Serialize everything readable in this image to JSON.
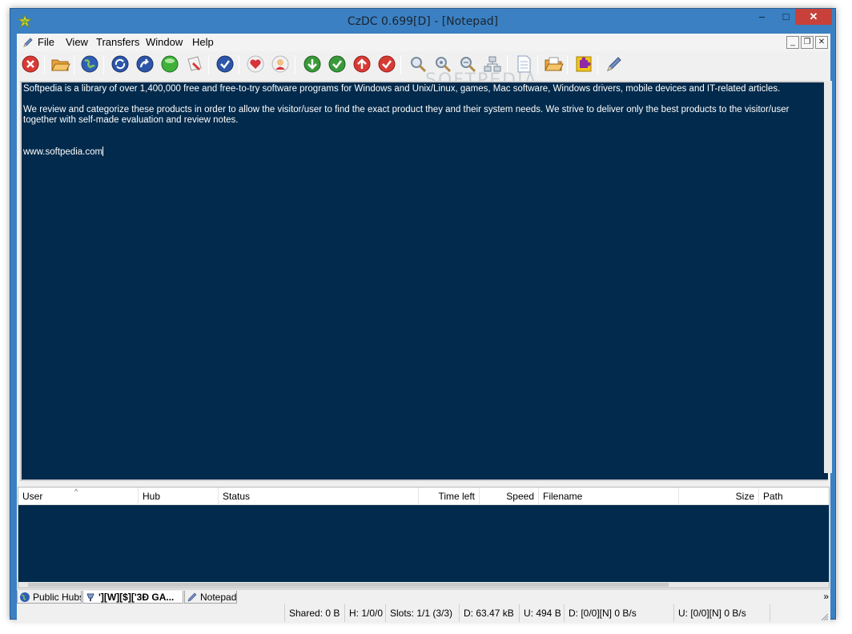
{
  "window": {
    "title": "CzDC 0.699[D] - [Notepad]",
    "controls": {
      "minimize": "–",
      "maximize": "□",
      "close": "✕"
    }
  },
  "menu": {
    "items": [
      "File",
      "View",
      "Transfers",
      "Window",
      "Help"
    ],
    "mdi_controls": {
      "minimize": "_",
      "restore": "❐",
      "close": "✕"
    }
  },
  "toolbar": {
    "buttons": [
      "disconnect-icon",
      "open-folder-icon",
      "public-hubs-icon",
      "reconnect-icon",
      "follow-redirect-icon",
      "favorite-hubs-icon",
      "favorite-users-icon",
      "recent-hubs-icon",
      "favorite-heart-icon",
      "users-icon",
      "download-queue-icon",
      "finished-downloads-icon",
      "upload-queue-icon",
      "finished-uploads-icon",
      "search-icon",
      "search-spy-icon",
      "adl-search-icon",
      "network-stats-icon",
      "notepad-file-icon",
      "open-file-list-icon",
      "plugins-icon",
      "settings-icon"
    ],
    "watermark": "SOFTPEDIA"
  },
  "notepad": {
    "lines": [
      "Softpedia is a library of over 1,400,000 free and free-to-try software programs for Windows and Unix/Linux, games, Mac software, Windows drivers, mobile devices and IT-related articles.",
      "",
      "We review and categorize these products in order to allow the visitor/user to find the exact product they and their system needs. We strive to deliver only the best products to the visitor/user together with self-made evaluation and review notes.",
      "",
      "",
      "www.softpedia.com"
    ],
    "background": "#012a4c",
    "text_color": "#ffffff"
  },
  "transfers": {
    "columns": [
      "User",
      "Hub",
      "Status",
      "Time left",
      "Speed",
      "Filename",
      "Size",
      "Path"
    ],
    "rows": []
  },
  "tabs": [
    {
      "label": "Public Hubs",
      "icon": "globe-icon",
      "active": false
    },
    {
      "label": "'][W][$]['3Ð GA...",
      "icon": "hub-icon",
      "active": true
    },
    {
      "label": "Notepad",
      "icon": "pencil-icon",
      "active": false
    }
  ],
  "tabs_more": "»",
  "status": {
    "shared": "Shared: 0 B",
    "hubs": "H: 1/0/0",
    "slots": "Slots: 1/1 (3/3)",
    "downloaded": "D: 63.47 kB",
    "uploaded": "U: 494 B",
    "download_rate": "D: [0/0][N] 0 B/s",
    "upload_rate": "U: [0/0][N] 0 B/s"
  },
  "colors": {
    "window_frame": "#3b80c2",
    "close_button": "#c7413a",
    "panel_background": "#012a4c"
  }
}
